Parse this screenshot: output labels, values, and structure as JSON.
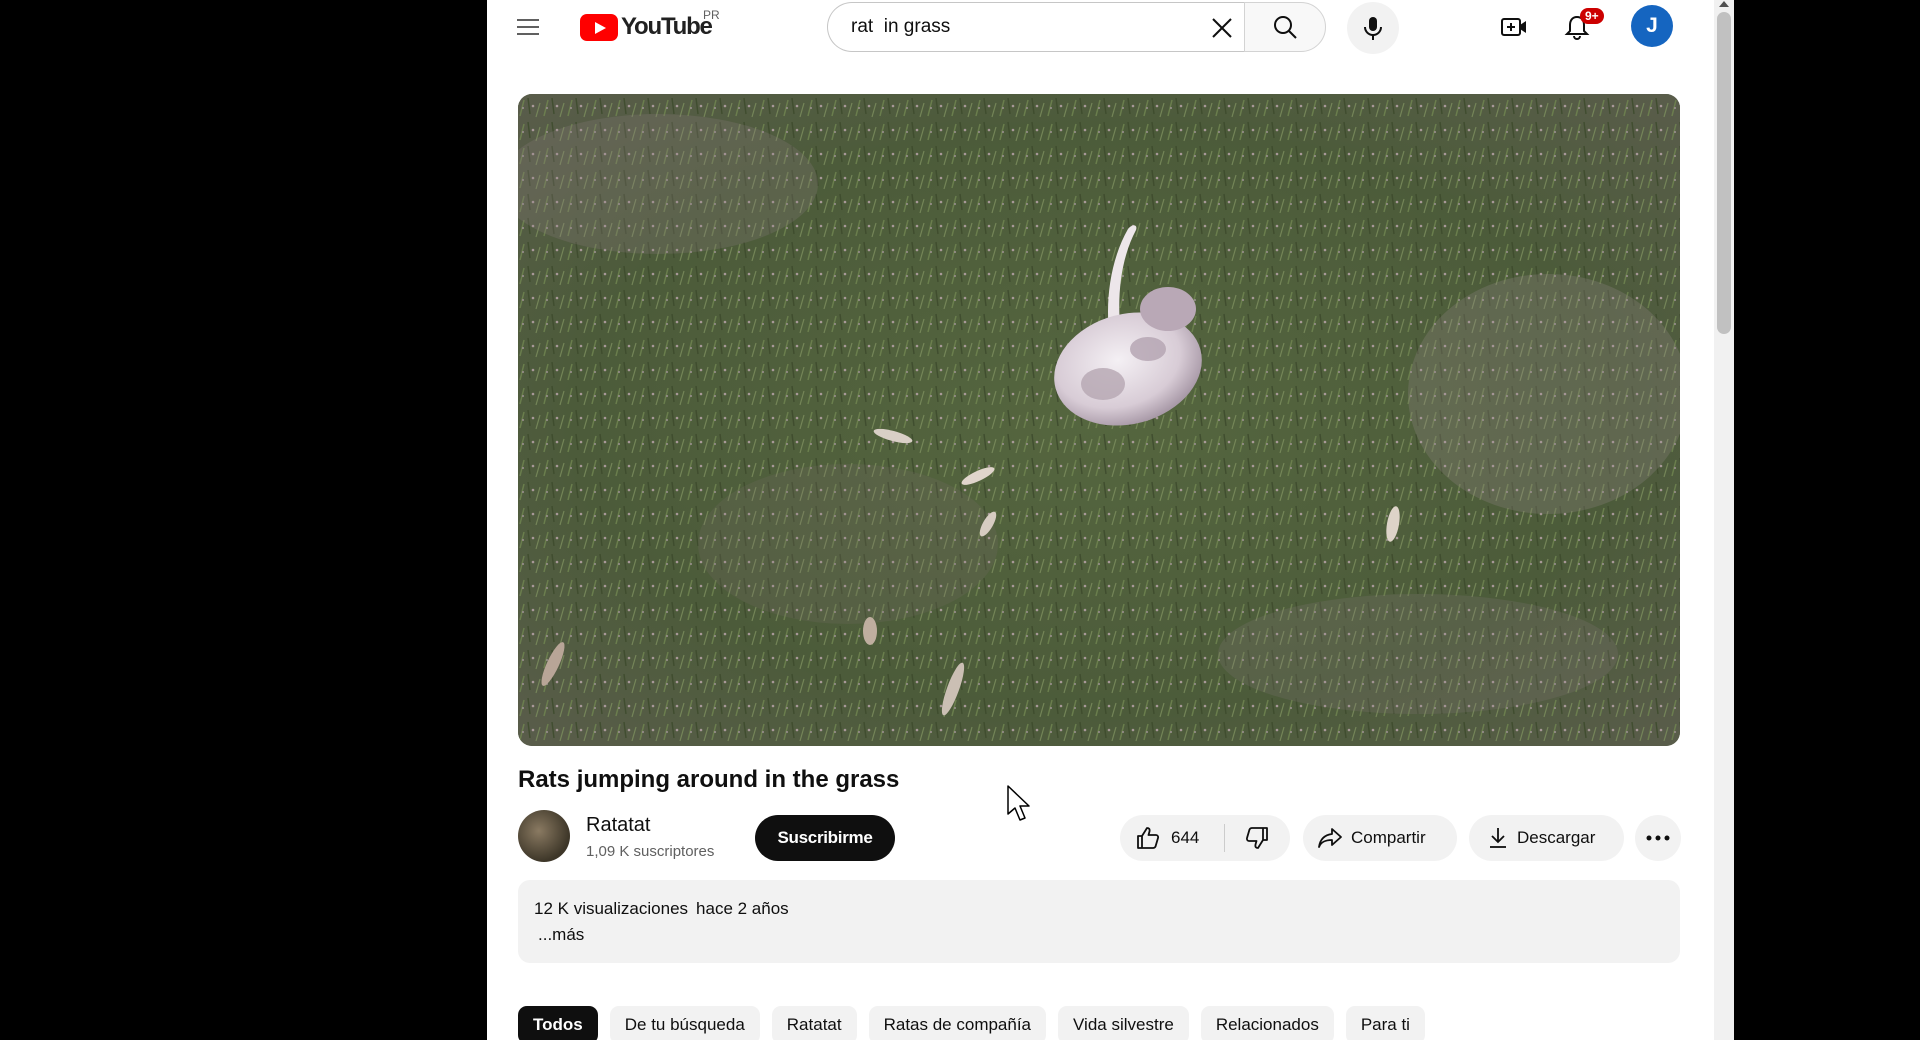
{
  "header": {
    "logo_text": "YouTube",
    "logo_region": "PR",
    "search_value": "rat  in grass",
    "notification_badge": "9+",
    "avatar_letter": "J"
  },
  "video": {
    "title": "Rats jumping around in the grass"
  },
  "channel": {
    "name": "Ratatat",
    "subscribers": "1,09 K suscriptores",
    "subscribe_label": "Suscribirme"
  },
  "actions": {
    "like_count": "644",
    "share_label": "Compartir",
    "download_label": "Descargar"
  },
  "description": {
    "views": "12 K visualizaciones",
    "date": "hace 2 años",
    "more_label": "...más"
  },
  "chips": [
    "Todos",
    "De tu búsqueda",
    "Ratatat",
    "Ratas de compañía",
    "Vida silvestre",
    "Relacionados",
    "Para ti"
  ],
  "colors": {
    "brand_red": "#ff0000",
    "avatar_blue": "#1565c0",
    "badge_red": "#cc0000"
  }
}
